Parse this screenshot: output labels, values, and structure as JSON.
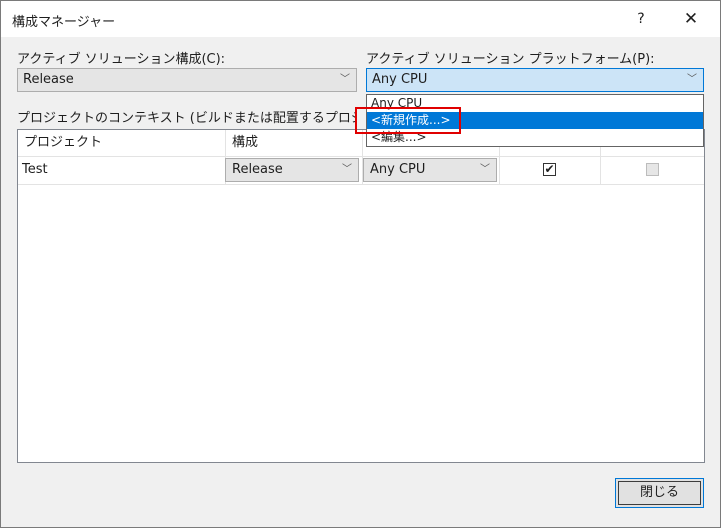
{
  "window": {
    "title": "構成マネージャー",
    "help_label": "?",
    "close_label": "✕"
  },
  "active_config": {
    "label": "アクティブ ソリューション構成(C):",
    "value": "Release"
  },
  "active_platform": {
    "label": "アクティブ ソリューション プラットフォーム(P):",
    "value": "Any CPU",
    "options": [
      "Any CPU",
      "<新規作成...>",
      "<編集...>"
    ],
    "selected_index": 1
  },
  "context_label": "プロジェクトのコンテキスト (ビルドまたは配置するプロジェクト構成をチ",
  "grid": {
    "headers": {
      "project": "プロジェクト",
      "config": "構成"
    },
    "rows": [
      {
        "project": "Test",
        "config": "Release",
        "platform": "Any CPU",
        "build": true,
        "deploy": false
      }
    ]
  },
  "buttons": {
    "close": "閉じる"
  },
  "icons": {
    "dropdown_arrow": "chevron-down-icon",
    "checkmark": "check-icon"
  },
  "colors": {
    "accent": "#0078d7",
    "highlight_border": "#e00000"
  }
}
